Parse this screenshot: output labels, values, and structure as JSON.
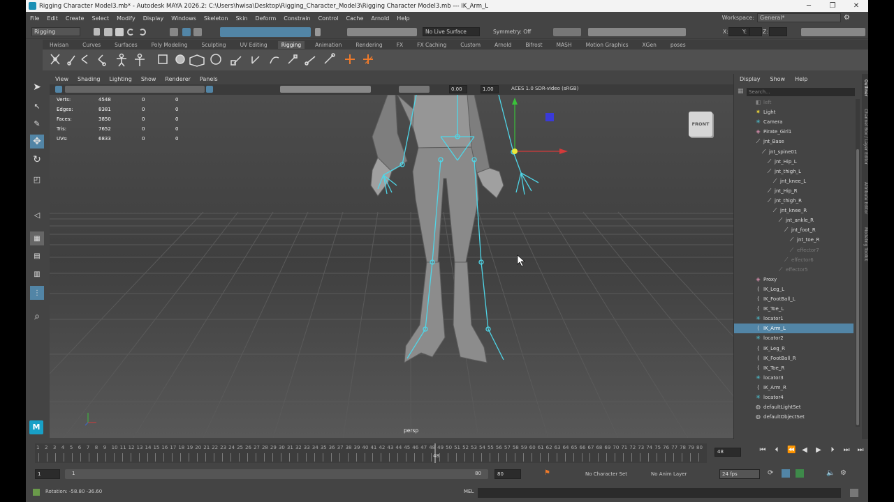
{
  "window": {
    "title": "Rigging Character Model3.mb* - Autodesk MAYA 2026.2: C:\\Users\\hwisa\\Desktop\\Rigging_Character_Model3\\Rigging Character Model3.mb   ---   IK_Arm_L",
    "minimize": "─",
    "restore": "❐",
    "close": "✕"
  },
  "menubar": [
    "File",
    "Edit",
    "Create",
    "Select",
    "Modify",
    "Display",
    "Windows",
    "Skeleton",
    "Skin",
    "Deform",
    "Constrain",
    "Control",
    "Cache",
    "Arnold",
    "Help"
  ],
  "workspace": {
    "label": "Workspace:",
    "value": "General*"
  },
  "statusline": {
    "menuset": "Rigging",
    "live_surface": "No Live Surface",
    "symmetry": "Symmetry: Off",
    "x_label": "X:",
    "y_label": "Y:",
    "z_label": "Z:"
  },
  "shelf_tabs": [
    "Hwisan",
    "Curves",
    "Surfaces",
    "Poly Modeling",
    "Sculpting",
    "UV Editing",
    "Rigging",
    "Animation",
    "Rendering",
    "FX",
    "FX Caching",
    "Custom",
    "Arnold",
    "Bifrost",
    "MASH",
    "Motion Graphics",
    "XGen",
    "poses"
  ],
  "active_shelf": "Rigging",
  "viewport": {
    "menu": [
      "View",
      "Shading",
      "Lighting",
      "Show",
      "Renderer",
      "Panels"
    ],
    "exposure": "0.00",
    "gamma": "1.00",
    "colorspace": "ACES 1.0 SDR-video (sRGB)",
    "camera": "persp",
    "viewcube_label": "FRONT",
    "hud": [
      {
        "label": "Verts:",
        "v1": "4548",
        "v2": "0",
        "v3": "0"
      },
      {
        "label": "Edges:",
        "v1": "8381",
        "v2": "0",
        "v3": "0"
      },
      {
        "label": "Faces:",
        "v1": "3850",
        "v2": "0",
        "v3": "0"
      },
      {
        "label": "Tris:",
        "v1": "7652",
        "v2": "0",
        "v3": "0"
      },
      {
        "label": "UVs:",
        "v1": "6833",
        "v2": "0",
        "v3": "0"
      }
    ]
  },
  "outliner": {
    "menu": [
      "Display",
      "Show",
      "Help"
    ],
    "search_placeholder": "Search...",
    "items": [
      {
        "label": "left",
        "icon": "camera-icon",
        "dim": true
      },
      {
        "label": "Light",
        "icon": "light-icon"
      },
      {
        "label": "Camera",
        "icon": "locator-icon"
      },
      {
        "label": "Pirate_Girl1",
        "icon": "mesh-icon"
      },
      {
        "label": "jnt_Base",
        "icon": "joint-icon"
      },
      {
        "label": "jnt_spine01",
        "icon": "joint-icon"
      },
      {
        "label": "jnt_Hip_L",
        "icon": "joint-icon"
      },
      {
        "label": "jnt_thigh_L",
        "icon": "joint-icon"
      },
      {
        "label": "jnt_knee_L",
        "icon": "joint-icon"
      },
      {
        "label": "jnt_Hip_R",
        "icon": "joint-icon"
      },
      {
        "label": "jnt_thigh_R",
        "icon": "joint-icon"
      },
      {
        "label": "jnt_knee_R",
        "icon": "joint-icon"
      },
      {
        "label": "jnt_ankle_R",
        "icon": "joint-icon"
      },
      {
        "label": "jnt_foot_R",
        "icon": "joint-icon"
      },
      {
        "label": "jnt_toe_R",
        "icon": "joint-icon"
      },
      {
        "label": "effector7",
        "icon": "effector-icon",
        "dim": true
      },
      {
        "label": "effector6",
        "icon": "effector-icon",
        "dim": true
      },
      {
        "label": "effector5",
        "icon": "effector-icon",
        "dim": true
      },
      {
        "label": "Proxy",
        "icon": "mesh-icon"
      },
      {
        "label": "IK_Leg_L",
        "icon": "ik-icon"
      },
      {
        "label": "IK_FootBall_L",
        "icon": "ik-icon"
      },
      {
        "label": "IK_Toe_L",
        "icon": "ik-icon"
      },
      {
        "label": "locator1",
        "icon": "locator-icon"
      },
      {
        "label": "IK_Arm_L",
        "icon": "ik-icon",
        "selected": true
      },
      {
        "label": "locator2",
        "icon": "locator-icon"
      },
      {
        "label": "IK_Leg_R",
        "icon": "ik-icon"
      },
      {
        "label": "IK_FootBall_R",
        "icon": "ik-icon"
      },
      {
        "label": "IK_Toe_R",
        "icon": "ik-icon"
      },
      {
        "label": "locator3",
        "icon": "locator-icon"
      },
      {
        "label": "IK_Arm_R",
        "icon": "ik-icon"
      },
      {
        "label": "locator4",
        "icon": "locator-icon"
      },
      {
        "label": "defaultLightSet",
        "icon": "set-icon"
      },
      {
        "label": "defaultObjectSet",
        "icon": "set-icon"
      }
    ],
    "side_tabs": [
      "Outliner",
      "Channel Box / Layer Editor",
      "Attribute Editor",
      "Modeling Toolkit"
    ]
  },
  "timeline": {
    "ticks": [
      "1",
      "2",
      "3",
      "4",
      "5",
      "6",
      "7",
      "8",
      "9",
      "10",
      "11",
      "12",
      "13",
      "14",
      "15",
      "16",
      "17",
      "18",
      "19",
      "20",
      "21",
      "22",
      "23",
      "24",
      "25",
      "26",
      "27",
      "28",
      "29",
      "30",
      "31",
      "32",
      "33",
      "34",
      "35",
      "36",
      "37",
      "38",
      "39",
      "40",
      "41",
      "42",
      "43",
      "44",
      "45",
      "46",
      "47",
      "48",
      "49",
      "50",
      "51",
      "52",
      "53",
      "54",
      "55",
      "56",
      "57",
      "58",
      "59",
      "60",
      "61",
      "62",
      "63",
      "64",
      "65",
      "66",
      "67",
      "68",
      "69",
      "70",
      "71",
      "72",
      "73",
      "74",
      "75",
      "76",
      "77",
      "78",
      "79",
      "80"
    ],
    "current_frame": "48",
    "current_frame_field": "48"
  },
  "range": {
    "start": "1",
    "anim_start": "1",
    "anim_end_inner": "80",
    "end": "80",
    "character_set": "No Character Set",
    "anim_layer": "No Anim Layer",
    "fps": "24 fps"
  },
  "help_line": "Rotation:   -58.80      -36.60",
  "cmd_label": "MEL",
  "colors": {
    "selection": "#5285a6",
    "joint": "#4fd6e8",
    "maya_blue": "#18a0c7"
  }
}
